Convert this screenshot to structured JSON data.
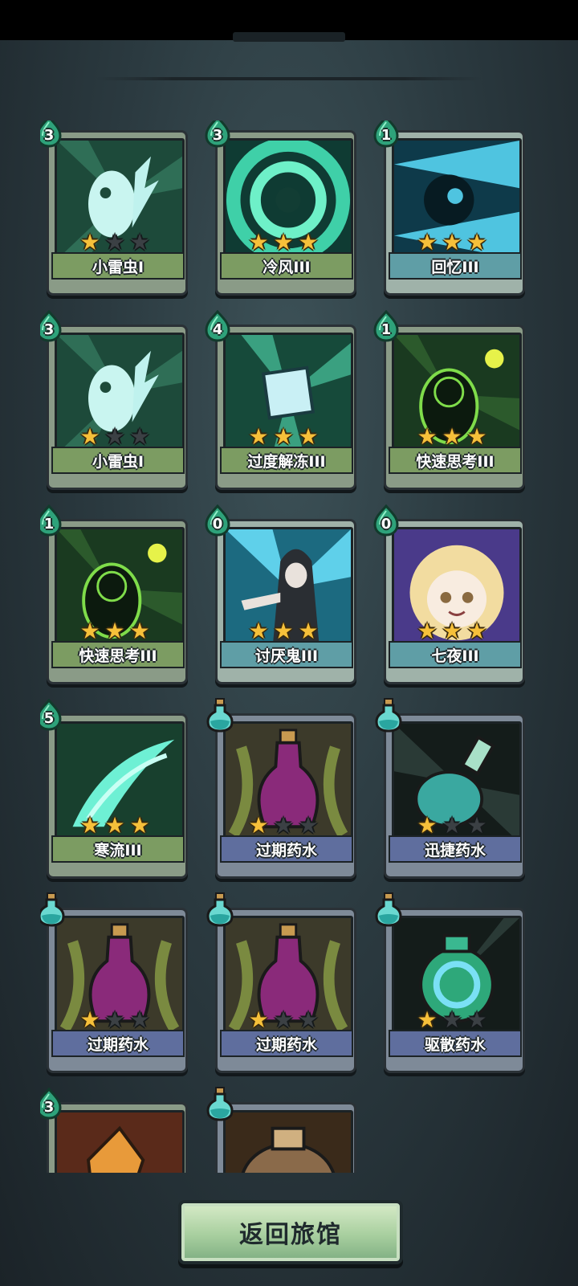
{
  "return_button": {
    "label": "返回旅馆"
  },
  "star_glyph": "★",
  "cards": [
    {
      "name": "小雷虫I",
      "kind": "skill",
      "rare": false,
      "cost": "3",
      "stars": 1,
      "art_icon": "thunder-bug-icon"
    },
    {
      "name": "冷风III",
      "kind": "skill",
      "rare": false,
      "cost": "3",
      "stars": 3,
      "art_icon": "cold-wind-icon"
    },
    {
      "name": "回忆III",
      "kind": "skill",
      "rare": true,
      "cost": "1",
      "stars": 3,
      "art_icon": "memory-icon"
    },
    {
      "name": "小雷虫I",
      "kind": "skill",
      "rare": false,
      "cost": "3",
      "stars": 1,
      "art_icon": "thunder-bug-icon"
    },
    {
      "name": "过度解冻III",
      "kind": "skill",
      "rare": false,
      "cost": "4",
      "stars": 3,
      "art_icon": "ice-cube-icon"
    },
    {
      "name": "快速思考III",
      "kind": "skill",
      "rare": false,
      "cost": "1",
      "stars": 3,
      "art_icon": "quick-think-icon"
    },
    {
      "name": "快速思考III",
      "kind": "skill",
      "rare": false,
      "cost": "1",
      "stars": 3,
      "art_icon": "quick-think-icon"
    },
    {
      "name": "讨厌鬼III",
      "kind": "skill",
      "rare": true,
      "cost": "0",
      "stars": 3,
      "art_icon": "hooded-figure-icon"
    },
    {
      "name": "七夜III",
      "kind": "skill",
      "rare": true,
      "cost": "0",
      "stars": 3,
      "art_icon": "blonde-girl-icon"
    },
    {
      "name": "寒流III",
      "kind": "skill",
      "rare": false,
      "cost": "5",
      "stars": 3,
      "art_icon": "cold-current-icon"
    },
    {
      "name": "过期药水",
      "kind": "potion",
      "rare": false,
      "cost": "",
      "stars": 1,
      "art_icon": "purple-potion-icon"
    },
    {
      "name": "迅捷药水",
      "kind": "potion",
      "rare": false,
      "cost": "",
      "stars": 1,
      "art_icon": "swift-potion-icon"
    },
    {
      "name": "过期药水",
      "kind": "potion",
      "rare": false,
      "cost": "",
      "stars": 1,
      "art_icon": "purple-potion-icon"
    },
    {
      "name": "过期药水",
      "kind": "potion",
      "rare": false,
      "cost": "",
      "stars": 1,
      "art_icon": "purple-potion-icon"
    },
    {
      "name": "驱散药水",
      "kind": "potion",
      "rare": false,
      "cost": "",
      "stars": 1,
      "art_icon": "dispel-potion-icon"
    },
    {
      "name": "",
      "kind": "skill",
      "rare": false,
      "cost": "3",
      "stars": 0,
      "art_icon": "crystal-icon"
    },
    {
      "name": "",
      "kind": "potion",
      "rare": false,
      "cost": "",
      "stars": 0,
      "art_icon": "potion-icon"
    }
  ],
  "colors": {
    "skill_plate": "#7c9c62",
    "rare_plate": "#5f9ea6",
    "potion_plate": "#5f6e9e",
    "star_on": "#f6c03a",
    "star_off": "#3b4044",
    "button": "#a8cf9f"
  }
}
